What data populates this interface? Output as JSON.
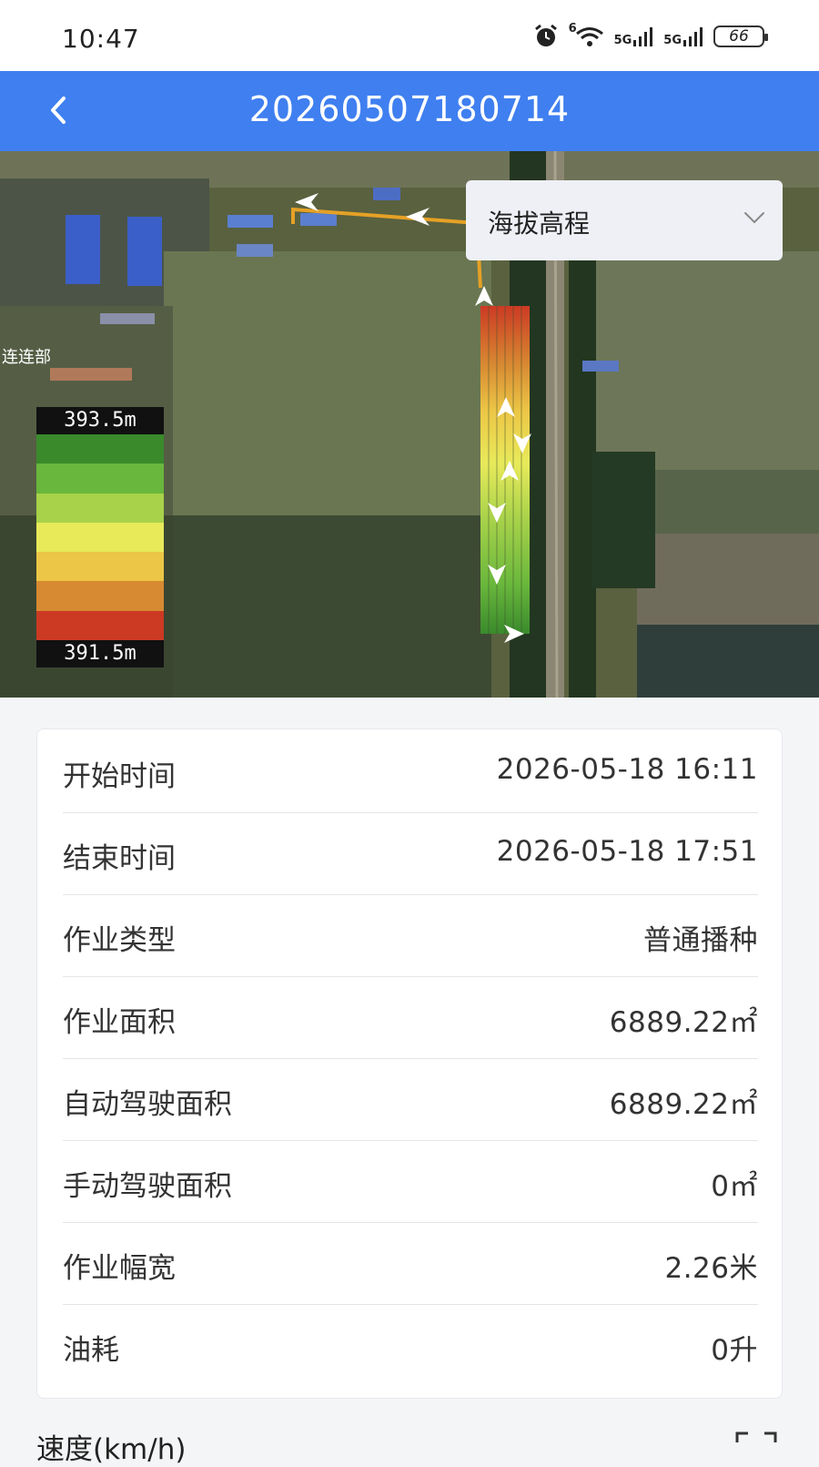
{
  "status_bar": {
    "time": "10:47",
    "icons": [
      "alarm-icon",
      "wifi-icon",
      "5g-signal-icon",
      "5g-signal-icon",
      "battery-icon"
    ],
    "network_1": "5G",
    "network_2": "5G",
    "wifi_badge": "6",
    "battery": "66"
  },
  "header": {
    "title": "20260507180714",
    "back_icon": "chevron-left-icon",
    "color": "#3f7ff0"
  },
  "map": {
    "place_label": "连连部",
    "layer_select": {
      "selected": "海拔高程"
    },
    "legend": {
      "max": "393.5m",
      "min": "391.5m",
      "colors": [
        "#3a8a2c",
        "#69b73c",
        "#a8d24a",
        "#e8ea5a",
        "#ecc646",
        "#d88a32",
        "#cc3a24"
      ]
    }
  },
  "details": [
    {
      "label": "开始时间",
      "value": "2026-05-18 16:11"
    },
    {
      "label": "结束时间",
      "value": "2026-05-18 17:51"
    },
    {
      "label": "作业类型",
      "value": "普通播种"
    },
    {
      "label": "作业面积",
      "value": "6889.22㎡"
    },
    {
      "label": "自动驾驶面积",
      "value": "6889.22㎡"
    },
    {
      "label": "手动驾驶面积",
      "value": "0㎡"
    },
    {
      "label": "作业幅宽",
      "value": "2.26米"
    },
    {
      "label": "油耗",
      "value": "0升"
    }
  ],
  "speed_section": {
    "title": "速度(km/h)"
  }
}
